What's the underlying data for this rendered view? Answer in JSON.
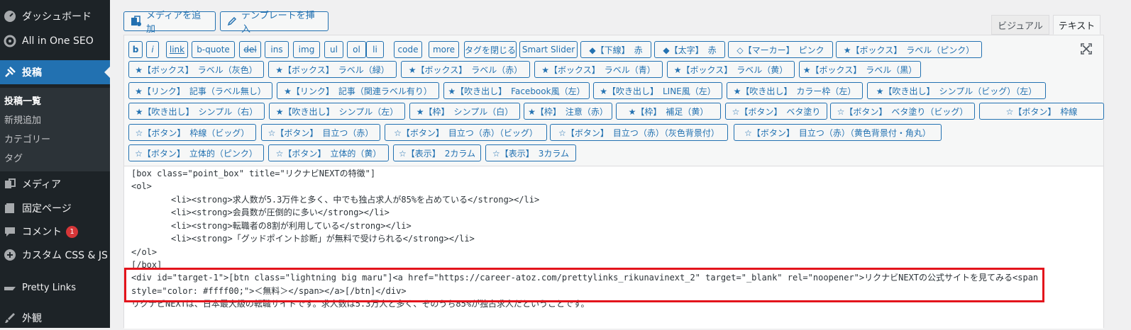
{
  "sidebar": {
    "dashboard": "ダッシュボード",
    "seo": "All in One SEO",
    "posts": "投稿",
    "submenu": [
      "投稿一覧",
      "新規追加",
      "カテゴリー",
      "タグ"
    ],
    "media": "メディア",
    "pages": "固定ページ",
    "comments": "コメント",
    "comments_badge": "1",
    "custom_css": "カスタム CSS & JS",
    "pretty_links": "Pretty Links",
    "appearance": "外観"
  },
  "editor": {
    "add_media": "メディアを追加",
    "insert_template": "テンプレートを挿入",
    "tab_visual": "ビジュアル",
    "tab_text": "テキスト"
  },
  "quicktags": [
    [
      "b",
      "i",
      "link",
      "b-quote",
      "del",
      "ins",
      "img",
      "ul",
      "ol",
      "li",
      "code",
      "more",
      "タグを閉じる",
      "Smart Slider",
      "◆【下線】　赤",
      "◆【太字】　赤",
      "◇【マーカー】　ピンク",
      "★【ボックス】　ラベル（ピンク）"
    ],
    [
      "★【ボックス】　ラベル（灰色）",
      "★【ボックス】　ラベル（緑）",
      "★【ボックス】　ラベル（赤）",
      "★【ボックス】　ラベル（青）",
      "★【ボックス】　ラベル（黄）",
      "★【ボックス】　ラベル（黒）"
    ],
    [
      "★【リンク】　記事（ラベル無し）",
      "★【リンク】　記事（関連ラベル有り）",
      "★【吹き出し】　Facebook風（左）",
      "★【吹き出し】　LINE風（左）",
      "★【吹き出し】　カラー枠（左）",
      "★【吹き出し】　シンプル（ビッグ）（左）"
    ],
    [
      "★【吹き出し】　シンプル（右）",
      "★【吹き出し】　シンプル（左）",
      "★【枠】　シンプル（白）",
      "★【枠】　注意（赤）",
      "★【枠】　補足（黄）",
      "☆【ボタン】　ベタ塗り",
      "☆【ボタン】　ベタ塗り（ビッグ）",
      "☆【ボタン】　枠線"
    ],
    [
      "☆【ボタン】　枠線（ビッグ）",
      "☆【ボタン】　目立つ（赤）",
      "☆【ボタン】　目立つ（赤）（ビッグ）",
      "☆【ボタン】　目立つ（赤）（灰色背景付）",
      "☆【ボタン】　目立つ（赤）（黄色背景付・角丸）"
    ],
    [
      "☆【ボタン】　立体的（ピンク）",
      "☆【ボタン】　立体的（黄）",
      "☆【表示】　2カラム",
      "☆【表示】　3カラム"
    ]
  ],
  "code_lines": [
    "[box class=\"point_box\" title=\"リクナビNEXTの特徴\"]",
    "<ol>",
    "<li><strong>求人数が5.3万件と多く、中でも独占求人が85%を占めている</strong></li>",
    "<li><strong>会員数が圧倒的に多い</strong></li>",
    "<li><strong>転職者の8割が利用している</strong></li>",
    "<li><strong>「グッドポイント診断」が無料で受けられる</strong></li>",
    "</ol>",
    "[/box]",
    "<div id=\"target-1\">[btn class=\"lightning big maru\"]<a href=\"https://career-atoz.com/prettylinks_rikunavinext_2\" target=\"_blank\" rel=\"noopener\">リクナビNEXTの公式サイトを見てみる<span",
    "style=\"color: #ffff00;\">＜無料＞</span></a>[/btn]</div>",
    "リクナビNEXTは、日本最大級の転職サイトです。求人数は5.3万人と多く、そのうち85%が独占求人だということです。"
  ],
  "colors": {
    "sidebar_bg": "#1d2327",
    "accent": "#2271b1",
    "highlight_border": "#e3141c",
    "badge": "#d63638"
  }
}
